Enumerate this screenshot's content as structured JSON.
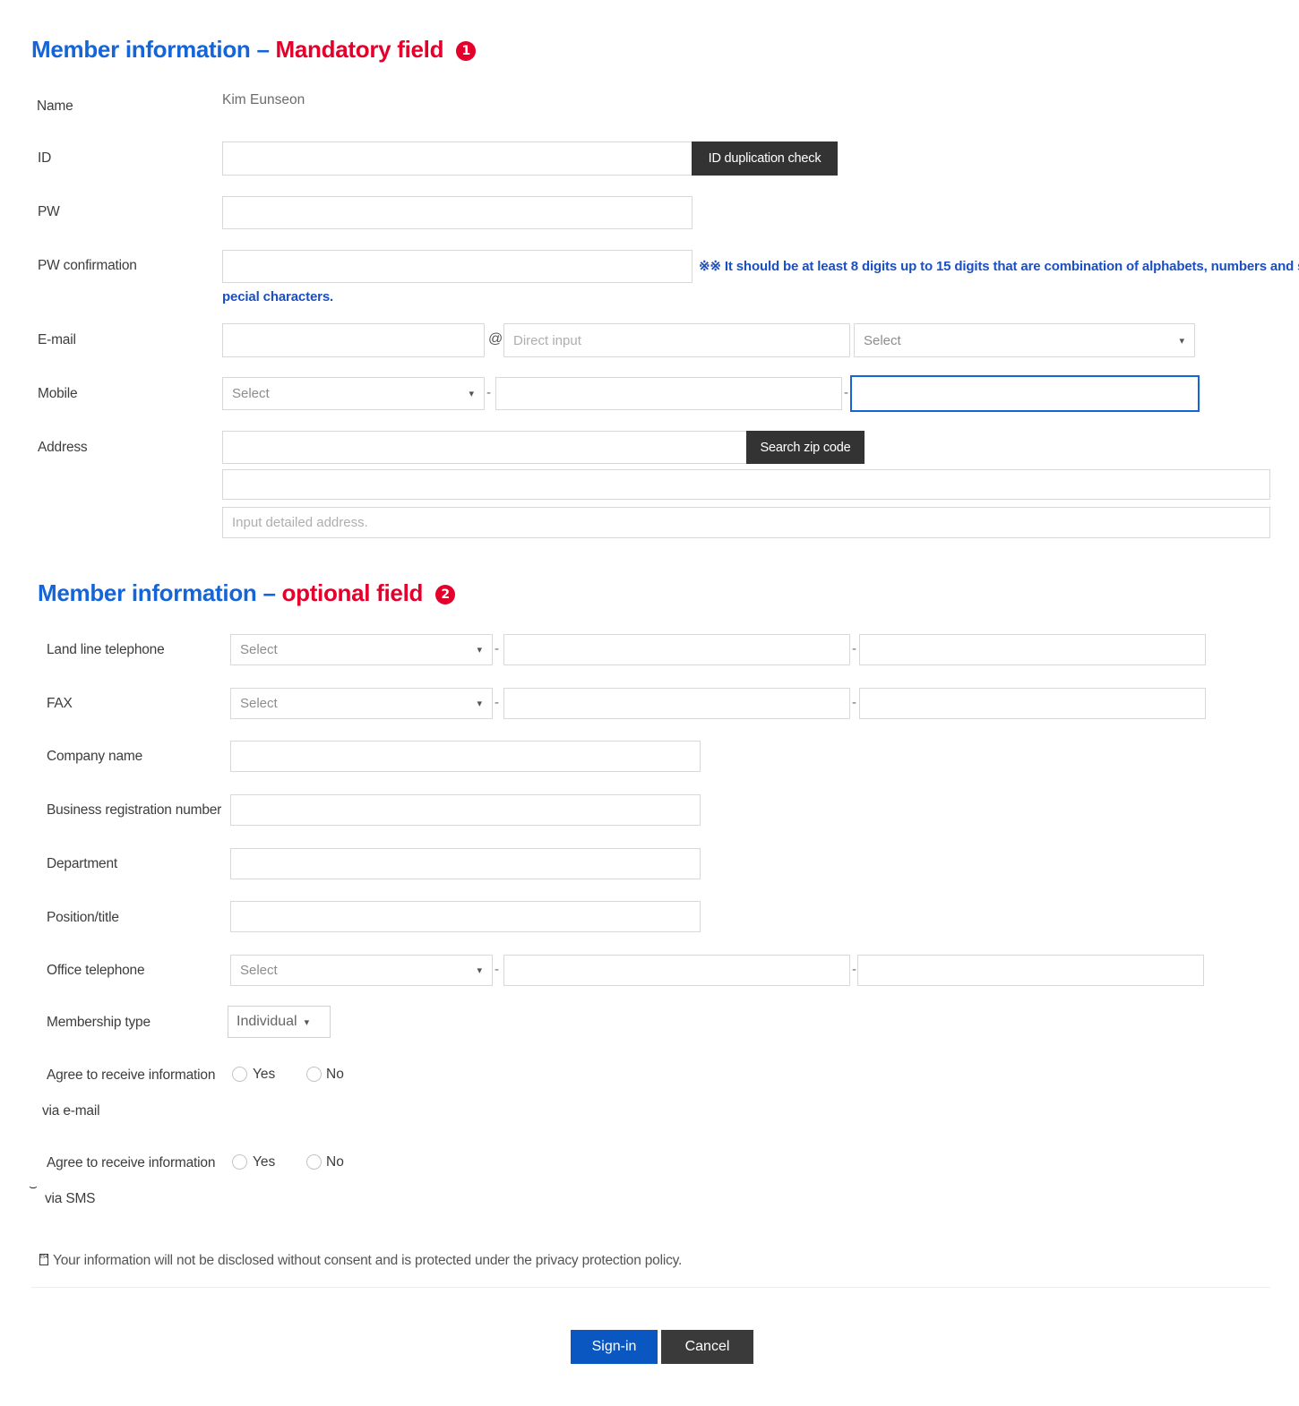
{
  "sections": {
    "mandatory": {
      "title_blue": "Member information",
      "title_dash": " – ",
      "title_red": "Mandatory field",
      "badge": "1"
    },
    "optional": {
      "title_blue": "Member information",
      "title_dash": " – ",
      "title_red": "optional field",
      "badge": "2"
    }
  },
  "mandatory_fields": {
    "name_label": "Name",
    "name_value": "Kim Eunseon",
    "id_label": "ID",
    "id_value": "",
    "id_dup_button": "ID duplication check",
    "pw_label": "PW",
    "pw_value": "",
    "pw_confirm_label": "PW confirmation",
    "pw_confirm_value": "",
    "pw_note": "※※ It should be at least 8 digits up to 15 digits that are combination of alphabets, numbers and s",
    "pw_note_line2": "pecial characters.",
    "email_label": "E-mail",
    "email_local_value": "",
    "email_at": "@",
    "email_domain_placeholder": "Direct input",
    "email_domain_value": "",
    "email_select_value": "Select",
    "mobile_label": "Mobile",
    "mobile_select_value": "Select",
    "mobile_part2_value": "",
    "mobile_part3_value": "",
    "address_label": "Address",
    "zip_value": "",
    "zip_button": "Search zip code",
    "address_main_value": "",
    "address_detail_placeholder": "Input detailed address.",
    "address_detail_value": "",
    "separator": "-"
  },
  "optional_fields": {
    "landline_label": "Land line telephone",
    "landline_select_value": "Select",
    "landline_part2_value": "",
    "landline_part3_value": "",
    "fax_label": "FAX",
    "fax_select_value": "Select",
    "fax_part2_value": "",
    "fax_part3_value": "",
    "company_label": "Company name",
    "company_value": "",
    "business_reg_label": "Business registration number",
    "business_reg_value": "",
    "department_label": "Department",
    "department_value": "",
    "position_label": "Position/title",
    "position_value": "",
    "office_tel_label": "Office telephone",
    "office_tel_select_value": "Select",
    "office_tel_part2_value": "",
    "office_tel_part3_value": "",
    "membership_type_label": "Membership type",
    "membership_type_value": "Individual",
    "agree_email_label": "Agree to receive information",
    "agree_email_label2": "via e-mail",
    "agree_sms_label": "Agree to receive information",
    "agree_sms_label2": "via SMS",
    "yes_label": "Yes",
    "no_label": "No",
    "separator": "-"
  },
  "footer": {
    "privacy_note": "Your information will not be disclosed without consent and is protected under the privacy protection policy.",
    "signin_button": "Sign-in",
    "cancel_button": "Cancel"
  },
  "colors": {
    "heading_blue": "#1565d8",
    "heading_red": "#e4002b",
    "badge_red": "#e4002b",
    "note_blue": "#1a4fc4",
    "focus_blue": "#1565d8",
    "primary_button": "#0b57c2",
    "dark_button": "#333333"
  }
}
